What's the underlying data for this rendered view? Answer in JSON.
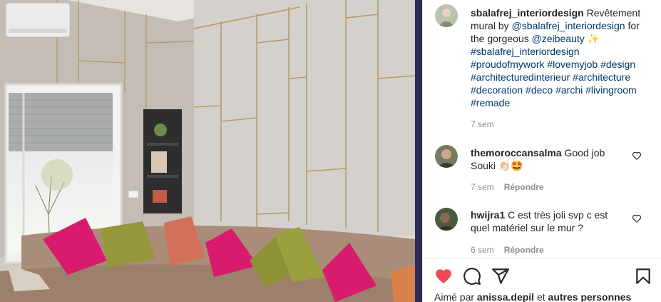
{
  "post": {
    "author": "sbalafrej_interiordesign",
    "caption_intro": "Revêtement mural by",
    "caption_mention_1": "@sbalafrej_interiordesign",
    "caption_for": "for the gorgeous",
    "caption_mention_2": "@zeibeauty",
    "caption_emoji": "✨",
    "hashtags_line_1": "#sbalafrej_interiordesign",
    "hashtags_line_2": "#proudofmywork #lovemyjob #design",
    "hashtags_line_3": "#architecturedinterieur #architecture",
    "hashtags_line_4": "#decoration #deco #archi #livingroom",
    "hashtags_line_5": "#remade",
    "time": "7 sem"
  },
  "comments": [
    {
      "user": "themoroccansalma",
      "text": "Good job Souki",
      "emoji": "👏🏻🤩",
      "time": "7 sem",
      "reply_label": "Répondre"
    },
    {
      "user": "hwijra1",
      "text_line_1": "C est très joli svp c est",
      "text_line_2": "quel matériel sur le mur ?",
      "time": "6 sem",
      "reply_label": "Répondre"
    }
  ],
  "likes": {
    "prefix": "Aimé par",
    "user": "anissa.depil",
    "conjunction": "et",
    "others": "autres personnes"
  },
  "icons": {
    "like": "heart-filled-icon",
    "comment": "comment-bubble-icon",
    "share": "paper-plane-icon",
    "save": "bookmark-icon",
    "comment_like": "heart-outline-icon"
  },
  "colors": {
    "heart": "#ed4956",
    "link": "#00376b",
    "meta": "#8e8e8e",
    "photo_border": "#2c2b57"
  }
}
